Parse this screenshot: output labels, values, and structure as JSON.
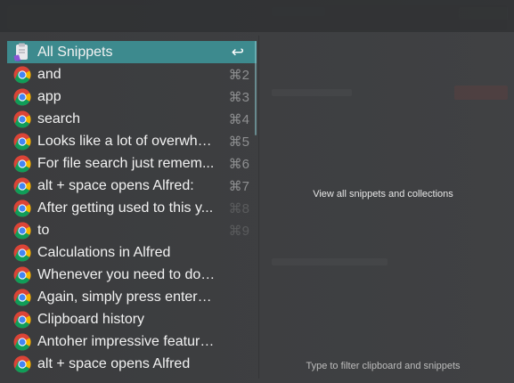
{
  "search": {
    "value": "",
    "placeholder": ""
  },
  "results": [
    {
      "label": "All Snippets",
      "shortcut": "↩",
      "icon": "snippets-icon",
      "selected": true
    },
    {
      "label": "and",
      "shortcut": "⌘2",
      "icon": "chrome-icon"
    },
    {
      "label": "app",
      "shortcut": "⌘3",
      "icon": "chrome-icon"
    },
    {
      "label": "search",
      "shortcut": "⌘4",
      "icon": "chrome-icon"
    },
    {
      "label": "Looks like a lot of overwhe...",
      "shortcut": "⌘5",
      "icon": "chrome-icon"
    },
    {
      "label": "For file search just remem...",
      "shortcut": "⌘6",
      "icon": "chrome-icon"
    },
    {
      "label": "alt + space opens Alfred:",
      "shortcut": "⌘7",
      "icon": "chrome-icon"
    },
    {
      "label": "After getting used to this y...",
      "shortcut": "⌘8",
      "icon": "chrome-icon"
    },
    {
      "label": "to",
      "shortcut": "⌘9",
      "icon": "chrome-icon"
    },
    {
      "label": "Calculations in Alfred",
      "shortcut": "",
      "icon": "chrome-icon"
    },
    {
      "label": "Whenever you need to do relat...",
      "shortcut": "",
      "icon": "chrome-icon"
    },
    {
      "label": "Again, simply press enter to sa...",
      "shortcut": "",
      "icon": "chrome-icon"
    },
    {
      "label": "Clipboard history",
      "shortcut": "",
      "icon": "chrome-icon"
    },
    {
      "label": "Antoher impressive feature is...",
      "shortcut": "",
      "icon": "chrome-icon"
    },
    {
      "label": "alt + space opens Alfred",
      "shortcut": "",
      "icon": "chrome-icon"
    }
  ],
  "preview": {
    "subtitle": "View all snippets and collections"
  },
  "footer": {
    "hint": "Type to filter clipboard and snippets"
  },
  "colors": {
    "selection": "#3d8a8e",
    "background": "#3b3c3e",
    "text": "#f2f2f2",
    "shortcut": "#8e8f91"
  }
}
